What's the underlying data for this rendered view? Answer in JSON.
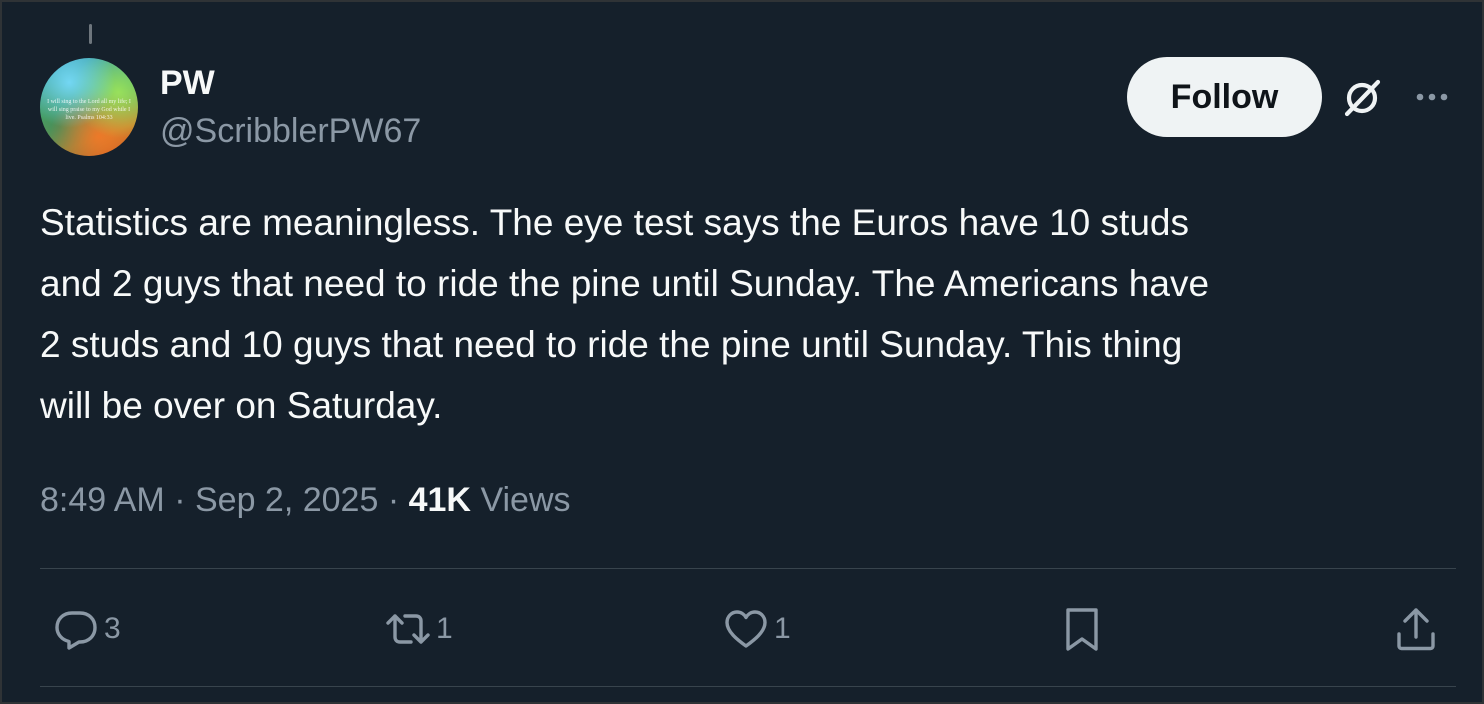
{
  "author": {
    "display_name": "PW",
    "handle": "@ScribblerPW67",
    "avatar_text": "I will sing to the Lord all my life; I will sing praise to my God while I live. Psalms 104:33"
  },
  "header": {
    "follow_label": "Follow"
  },
  "tweet": {
    "text": "Statistics are meaningless.  The eye test says the Euros have 10 studs\nand 2 guys that need to ride the pine until Sunday.  The Americans have\n2 studs and 10 guys that need to ride the pine until Sunday.  This thing\nwill be over on Saturday."
  },
  "meta": {
    "time": "8:49 AM",
    "separator": "·",
    "date": "Sep 2, 2025",
    "views_count": "41K",
    "views_label": "Views"
  },
  "actions": {
    "replies": "3",
    "reposts": "1",
    "likes": "1"
  },
  "colors": {
    "background": "#15202b",
    "text_primary": "#f7f9f9",
    "text_secondary": "#8b98a5",
    "divider": "#38444d",
    "follow_bg": "#eff3f4"
  },
  "icons": {
    "grok": "grok-icon",
    "more": "more-icon",
    "reply": "reply-icon",
    "repost": "repost-icon",
    "like": "heart-icon",
    "bookmark": "bookmark-icon",
    "share": "share-icon"
  }
}
